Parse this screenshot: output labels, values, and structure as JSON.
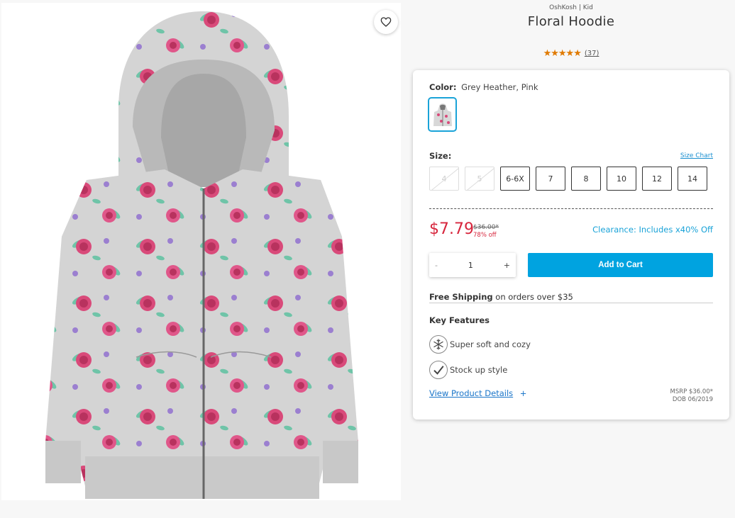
{
  "product": {
    "brand": "OshKosh | Kid",
    "title": "Floral Hoodie",
    "rating_stars": "★★★★★",
    "review_count": "(37)"
  },
  "favorite": {
    "icon": "heart-icon"
  },
  "color": {
    "label": "Color:",
    "value": "Grey Heather, Pink"
  },
  "size": {
    "label": "Size:",
    "chart_link": "Size Chart",
    "options": [
      {
        "label": "4",
        "available": false
      },
      {
        "label": "5",
        "available": false
      },
      {
        "label": "6-6X",
        "available": true
      },
      {
        "label": "7",
        "available": true
      },
      {
        "label": "8",
        "available": true
      },
      {
        "label": "10",
        "available": true
      },
      {
        "label": "12",
        "available": true
      },
      {
        "label": "14",
        "available": true
      }
    ]
  },
  "pricing": {
    "price": "$7.79",
    "original": "$36.00*",
    "percent_off": "78% off",
    "clearance": "Clearance: Includes x40% Off"
  },
  "cart": {
    "minus": "-",
    "quantity": "1",
    "plus": "+",
    "add_label": "Add to Cart"
  },
  "shipping": {
    "bold": "Free Shipping",
    "rest": " on orders over $35"
  },
  "features": {
    "title": "Key Features",
    "items": [
      {
        "icon": "snowflake-icon",
        "text": "Super soft and cozy"
      },
      {
        "icon": "checkmark-icon",
        "text": "Stock up style"
      }
    ]
  },
  "details": {
    "link": "View Product Details",
    "plus": "+",
    "msrp": "MSRP $36.00*",
    "dob": "DOB 06/2019"
  },
  "colors": {
    "accent": "#00a3e0",
    "sale": "#d7263d",
    "star": "#e07a00"
  }
}
